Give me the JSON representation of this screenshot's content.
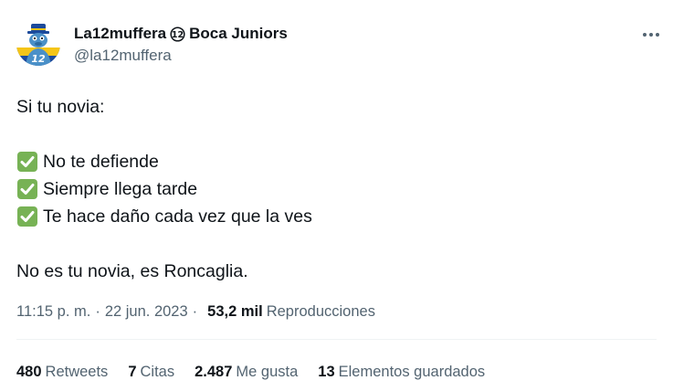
{
  "author": {
    "name": "La12muffera",
    "badge_icon": "number-12-badge-icon",
    "club": "Boca Juniors",
    "handle": "@la12muffera",
    "avatar_icon": "boca-juniors-mascot-avatar",
    "avatar_number": "12"
  },
  "more_icon": "ellipsis-horizontal-icon",
  "tweet": {
    "intro": "Si tu novia:",
    "checklist": [
      "No te defiende",
      "Siempre llega tarde",
      "Te hace daño cada vez que la ves"
    ],
    "check_icon": "check-mark-emoji-icon",
    "check_color": "#77b255",
    "closing": "No es tu novia, es Roncaglia."
  },
  "meta": {
    "time": "11:15 p. m.",
    "separator": "·",
    "date": "22 jun. 2023",
    "views_count": "53,2 mil",
    "views_label": "Reproducciones"
  },
  "stats": [
    {
      "count": "480",
      "label": "Retweets"
    },
    {
      "count": "7",
      "label": "Citas"
    },
    {
      "count": "2.487",
      "label": "Me gusta"
    },
    {
      "count": "13",
      "label": "Elementos guardados"
    }
  ],
  "colors": {
    "text_primary": "#0f1419",
    "text_secondary": "#536471",
    "divider": "#eff3f4",
    "boca_blue": "#1c4a9b",
    "boca_yellow": "#f5c518"
  }
}
